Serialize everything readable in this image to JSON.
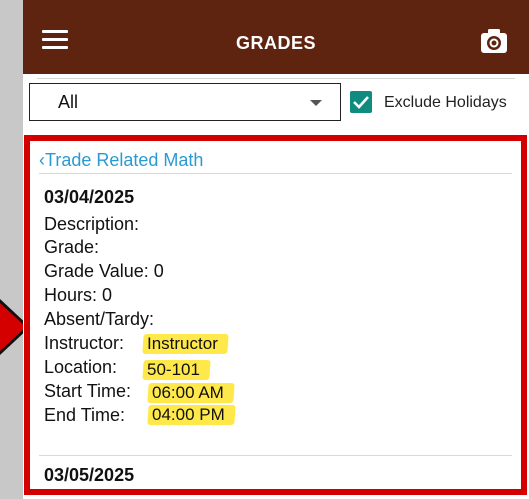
{
  "appbar": {
    "title": "GRADES",
    "menu_icon": "hamburger-menu-icon",
    "camera_icon": "camera-icon",
    "color": "#5f2410"
  },
  "filter": {
    "selected": "All",
    "exclude_holidays_label": "Exclude Holidays",
    "exclude_holidays_checked": true,
    "checkbox_color": "#0f8b80"
  },
  "course": {
    "back_label": "‹Trade Related Math"
  },
  "entries": [
    {
      "date": "03/04/2025",
      "description_label": "Description:",
      "grade_label": "Grade:",
      "grade_value_label": "Grade Value: 0",
      "hours_label": "Hours: 0",
      "absent_tardy_label": "Absent/Tardy:",
      "instructor_label": "Instructor:",
      "instructor_value": "Instructor",
      "location_label": "Location:",
      "location_value": "50-101",
      "start_time_label": "Start Time:",
      "start_time_value": "06:00 AM",
      "end_time_label": "End Time:",
      "end_time_value": "04:00 PM"
    },
    {
      "date": "03/05/2025"
    }
  ],
  "annotation": {
    "frame_color": "#d40000",
    "highlight_color": "#ffe84a"
  }
}
